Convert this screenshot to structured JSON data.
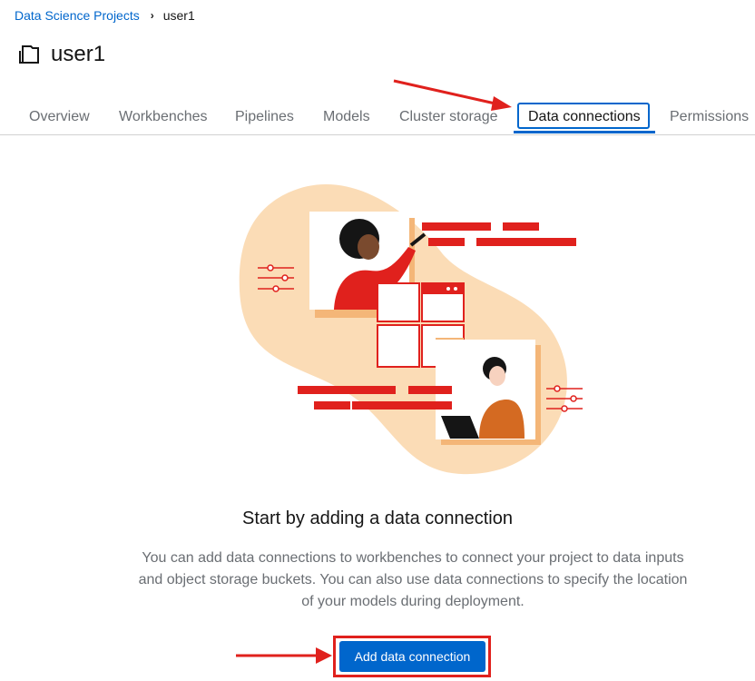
{
  "breadcrumb": {
    "parent": "Data Science Projects",
    "current": "user1"
  },
  "project": {
    "title": "user1"
  },
  "tabs": {
    "overview": "Overview",
    "workbenches": "Workbenches",
    "pipelines": "Pipelines",
    "models": "Models",
    "cluster_storage": "Cluster storage",
    "data_connections": "Data connections",
    "permissions": "Permissions"
  },
  "empty_state": {
    "title": "Start by adding a data connection",
    "body": "You can add data connections to workbenches to connect your project to data inputs and object storage buckets. You can also use data connections to specify the location of your models during deployment.",
    "button": "Add data connection"
  },
  "colors": {
    "accent": "#0066cc",
    "annotation": "#e0211d",
    "illustration_bg": "#fbdcb6"
  },
  "icons": {
    "project": "folder-icon",
    "separator": "chevron-right-icon"
  }
}
